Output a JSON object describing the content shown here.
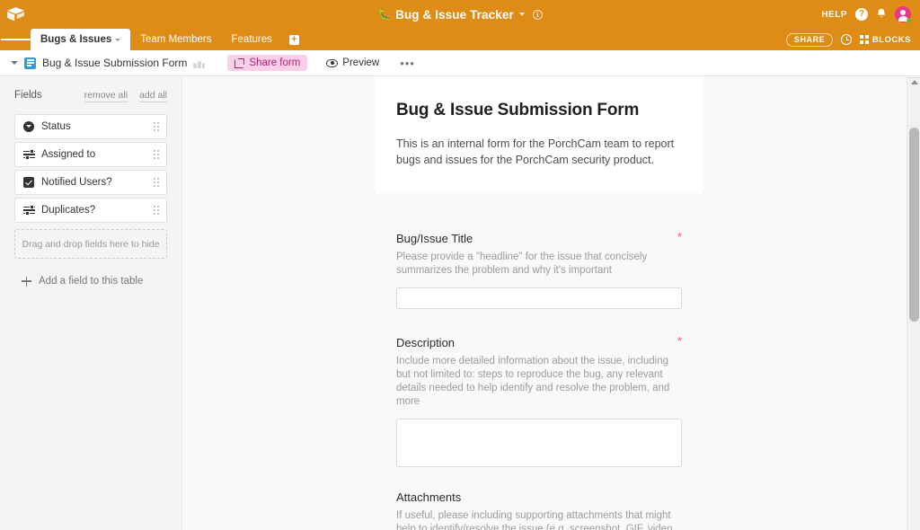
{
  "topbar": {
    "logo_icon": "airtable-logo-icon",
    "base_icon": "bug-icon",
    "base_name": "Bug & Issue Tracker",
    "base_caret_icon": "chevron-down-icon",
    "info_icon": "info-icon",
    "info_glyph": "i",
    "help_label": "HELP",
    "help_glyph": "?",
    "notifications_icon": "bell-icon",
    "notifications_glyph": "▲",
    "avatar_icon": "user-avatar",
    "brand_color": "#df8c16"
  },
  "tabbar": {
    "menu_icon": "hamburger-menu-icon",
    "tabs": [
      {
        "label": "Bugs & Issues",
        "active": true
      },
      {
        "label": "Team Members",
        "active": false
      },
      {
        "label": "Features",
        "active": false
      }
    ],
    "add_table_glyph": "+",
    "share_label": "SHARE",
    "history_icon": "history-clock-icon",
    "blocks_label": "BLOCKS",
    "blocks_icon": "blocks-grid-icon"
  },
  "viewbar": {
    "collapse_icon": "chevron-down-icon",
    "view_icon": "form-view-icon",
    "view_name": "Bug & Issue Submission Form",
    "collaborators_icon": "collaborators-icon",
    "share_form_label": "Share form",
    "share_form_icon": "external-link-icon",
    "share_form_bg": "#fbcfe8",
    "share_form_color": "#b0236f",
    "preview_label": "Preview",
    "preview_icon": "eye-icon",
    "more_glyph": "•••"
  },
  "sidebar": {
    "title": "Fields",
    "remove_all_label": "remove all",
    "add_all_label": "add all",
    "fields": [
      {
        "label": "Status",
        "icon": "single-select-icon"
      },
      {
        "label": "Assigned to",
        "icon": "linked-record-icon"
      },
      {
        "label": "Notified Users?",
        "icon": "checkbox-icon"
      },
      {
        "label": "Duplicates?",
        "icon": "linked-record-icon"
      }
    ],
    "dropzone_label": "Drag and drop fields here to hide",
    "add_field_label": "Add a field to this table",
    "add_field_icon": "plus-icon"
  },
  "form": {
    "title": "Bug & Issue Submission Form",
    "description": "This is an internal form for the PorchCam team to report bugs and issues for the PorchCam security product.",
    "required_marker": "*",
    "fields": [
      {
        "label": "Bug/Issue Title",
        "help": "Please provide a \"headline\" for the issue that concisely summarizes the problem and why it's important",
        "required": true,
        "input_type": "text",
        "value": ""
      },
      {
        "label": "Description",
        "help": "Include more detailed information about the issue, including but not limited to: steps to reproduce the bug, any relevant details needed to help identify and resolve the problem, and more",
        "required": true,
        "input_type": "textarea",
        "value": ""
      },
      {
        "label": "Attachments",
        "help": "If useful, please including supporting attachments that might help to identify/resolve the issue (e.g. screenshot, GIF, video,",
        "required": false,
        "input_type": "attachment",
        "value": ""
      }
    ]
  },
  "scrollbar": {
    "up_arrow_icon": "scroll-up-arrow-icon",
    "thumb": "scroll-thumb"
  }
}
